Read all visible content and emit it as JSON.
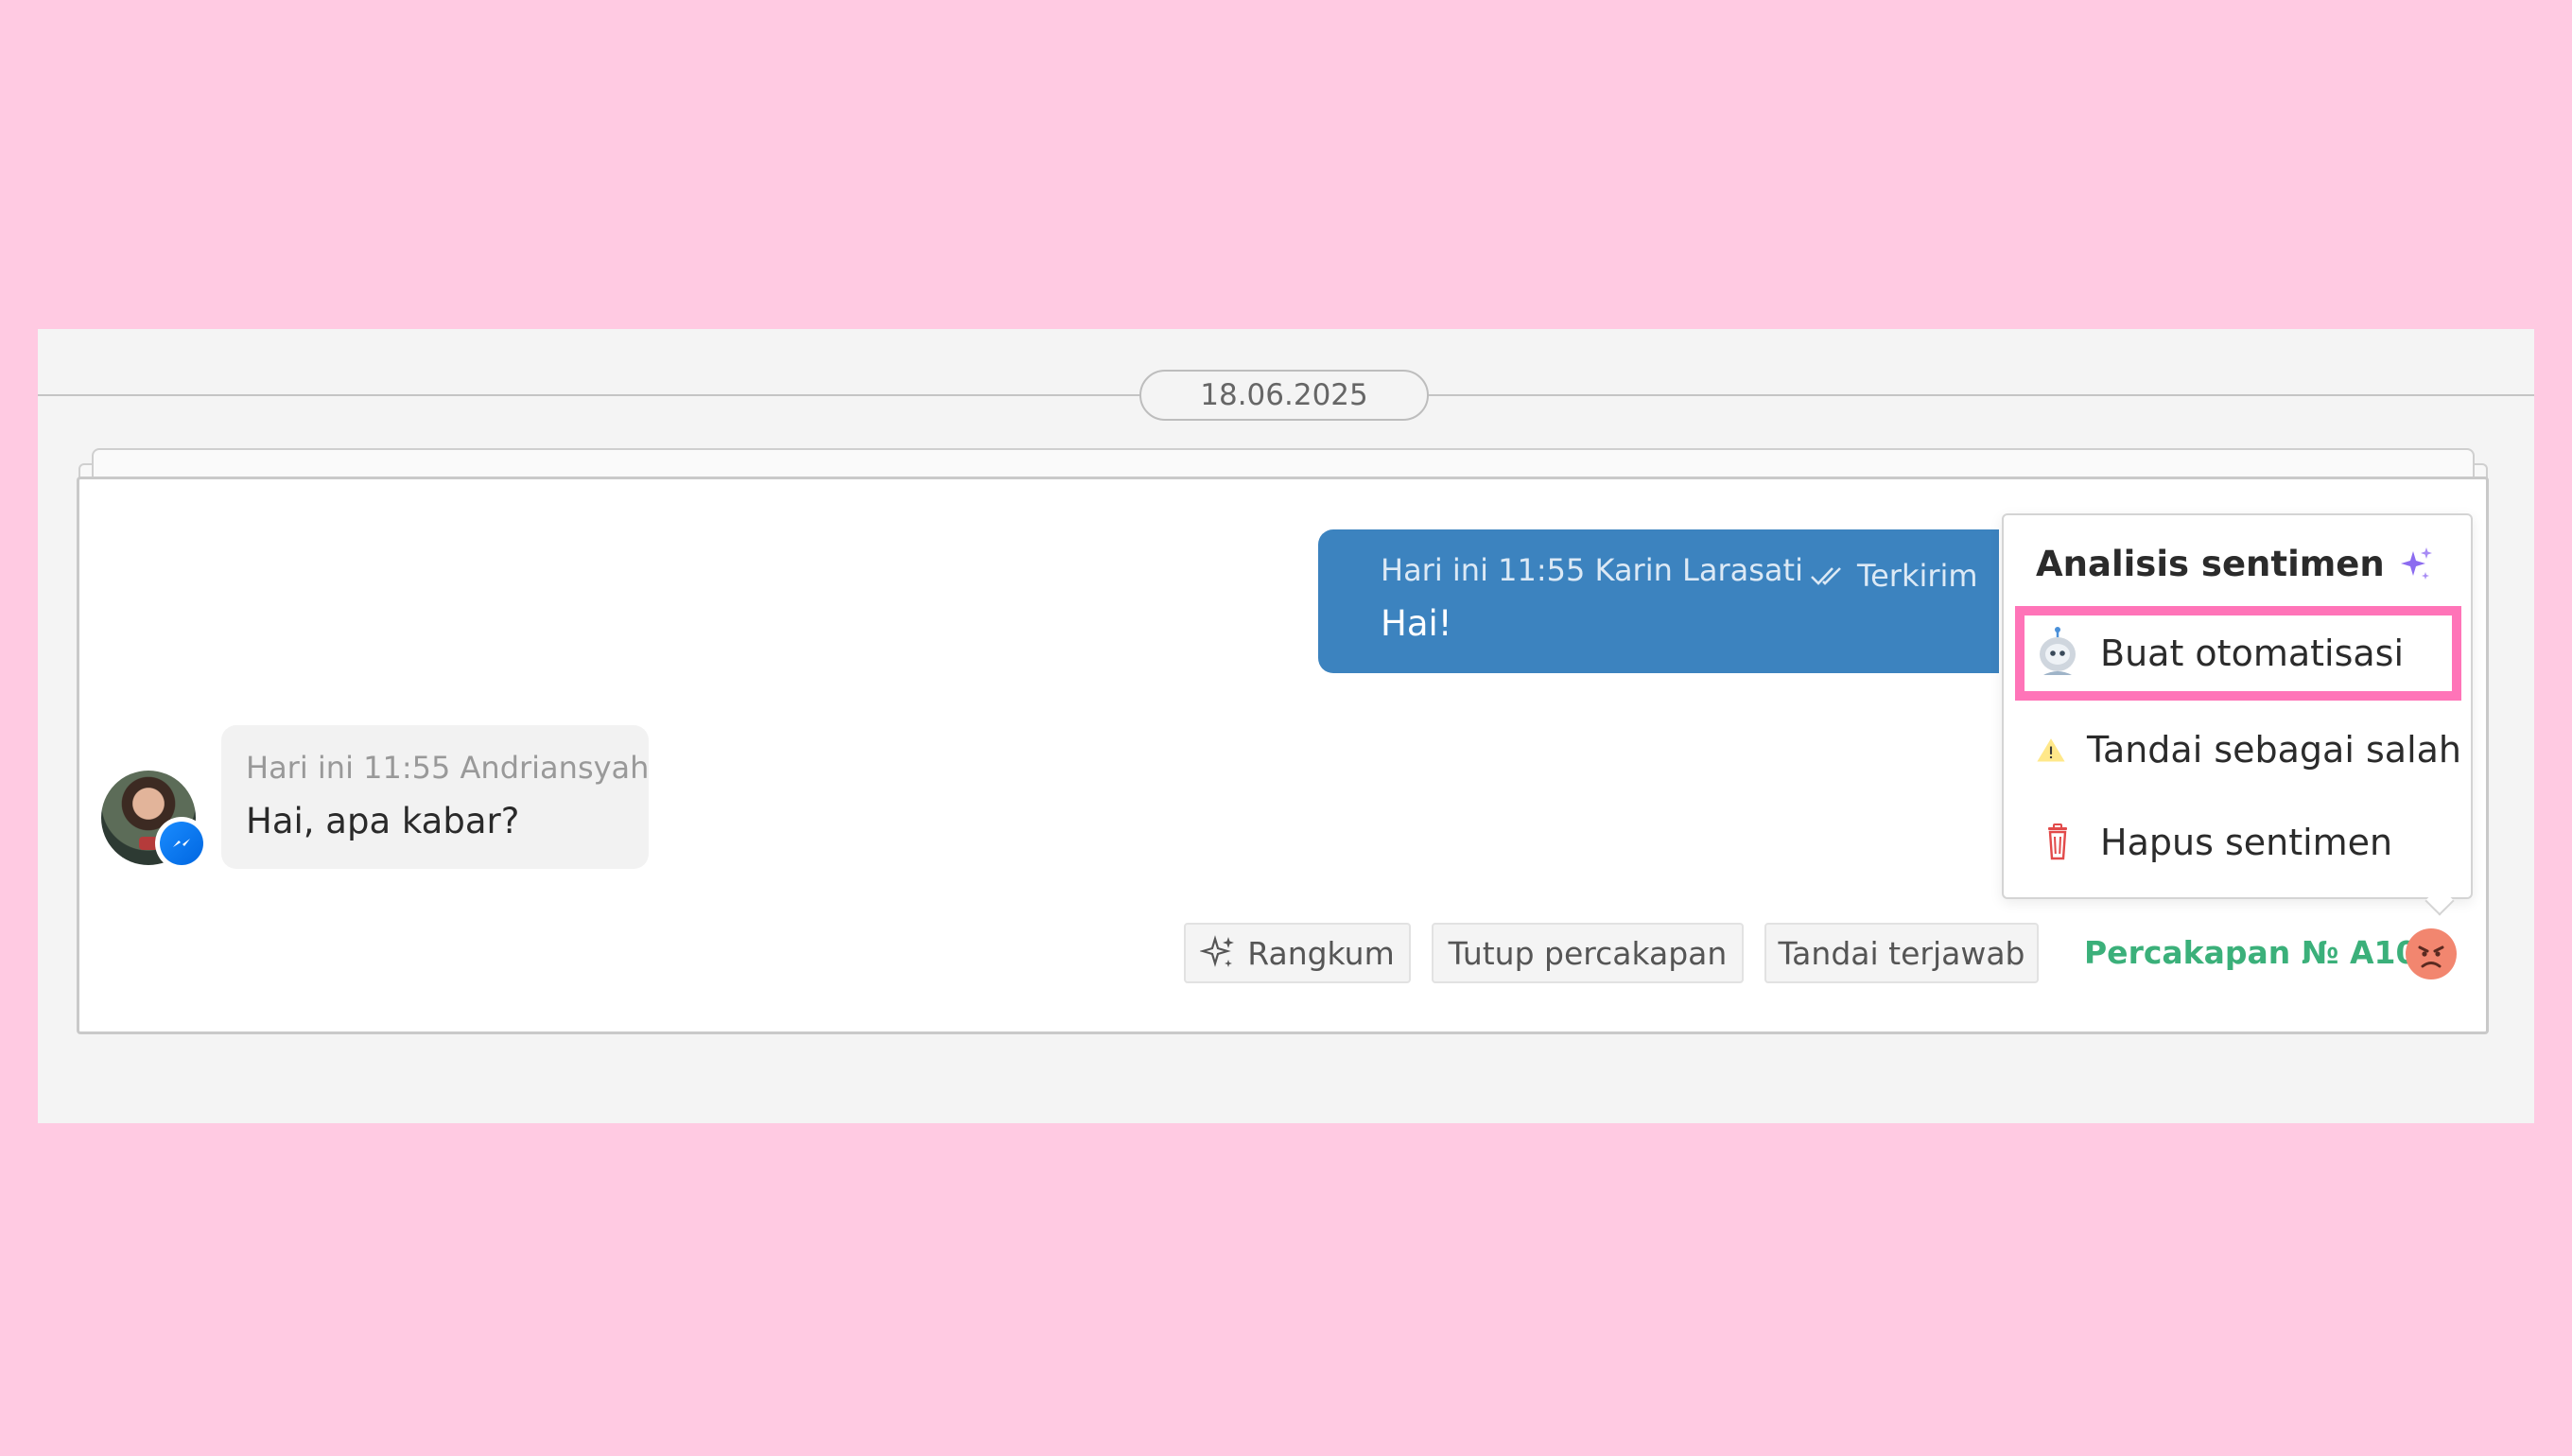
{
  "date_separator": "18.06.2025",
  "outgoing_message": {
    "meta": "Hari ini 11:55 Karin Larasati",
    "status": "Terkirim",
    "text": "Hai!"
  },
  "incoming_message": {
    "meta": "Hari ini 11:55 Andriansyah",
    "text": "Hai, apa kabar?",
    "channel_icon": "messenger-icon"
  },
  "actions": {
    "summarize": "Rangkum",
    "close": "Tutup percakapan",
    "mark_answered": "Tandai terjawab"
  },
  "conversation_label": "Percakapan № A100",
  "sentiment": {
    "icon": "angry-face-icon",
    "color": "#f2866f"
  },
  "sentiment_menu": {
    "title": "Analisis sentimen",
    "items": [
      {
        "label": "Buat otomatisasi",
        "icon": "robot-icon",
        "highlighted": true
      },
      {
        "label": "Tandai sebagai salah",
        "icon": "warning-icon"
      },
      {
        "label": "Hapus sentimen",
        "icon": "trash-icon"
      }
    ]
  },
  "colors": {
    "background": "#ffcae2",
    "outgoing_bubble": "#3c83bf",
    "link_green": "#3bb07a",
    "highlight": "#ff74b8",
    "ai_sparkle": "#8c6cf0"
  }
}
